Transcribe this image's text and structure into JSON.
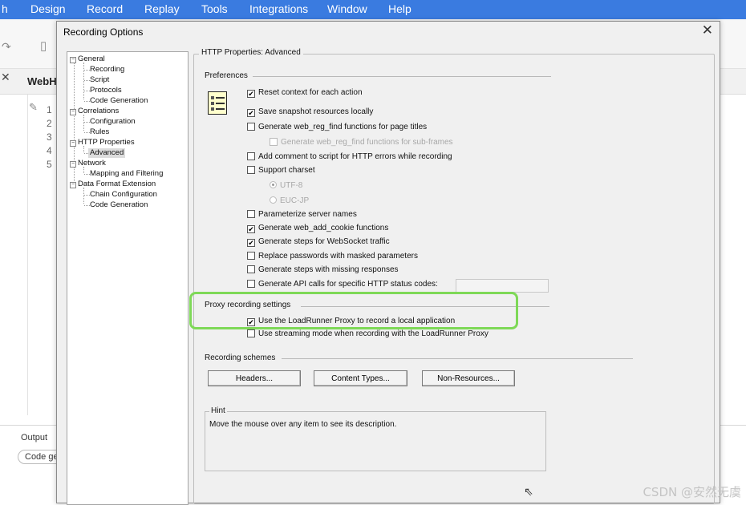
{
  "menubar": {
    "items": [
      "h",
      "Design",
      "Record",
      "Replay",
      "Tools",
      "Integrations",
      "Window",
      "Help"
    ]
  },
  "background": {
    "editor_tab": "WebH",
    "line_numbers": [
      "1",
      "2",
      "3",
      "4",
      "5"
    ],
    "output_label": "Output",
    "output_button": "Code ge",
    "accent_color": "#3a7be0"
  },
  "dialog": {
    "title": "Recording Options",
    "close_glyph": "✕"
  },
  "tree": [
    {
      "label": "General",
      "level": 0,
      "expander": "−"
    },
    {
      "label": "Recording",
      "level": 1
    },
    {
      "label": "Script",
      "level": 1
    },
    {
      "label": "Protocols",
      "level": 1
    },
    {
      "label": "Code Generation",
      "level": 1
    },
    {
      "label": "Correlations",
      "level": 0,
      "expander": "−"
    },
    {
      "label": "Configuration",
      "level": 1
    },
    {
      "label": "Rules",
      "level": 1
    },
    {
      "label": "HTTP Properties",
      "level": 0,
      "expander": "−"
    },
    {
      "label": "Advanced",
      "level": 1,
      "selected": true
    },
    {
      "label": "Network",
      "level": 0,
      "expander": "−"
    },
    {
      "label": "Mapping and Filtering",
      "level": 1
    },
    {
      "label": "Data Format Extension",
      "level": 0,
      "expander": "−"
    },
    {
      "label": "Chain Configuration",
      "level": 1
    },
    {
      "label": "Code Generation",
      "level": 1
    }
  ],
  "panel": {
    "title": "HTTP Properties: Advanced",
    "preferences_label": "Preferences",
    "preferences": [
      {
        "label": "Reset context for each action",
        "checked": true,
        "enabled": true
      },
      {
        "label": "Save snapshot resources locally",
        "checked": true,
        "enabled": true
      },
      {
        "label": "Generate web_reg_find functions for page titles",
        "checked": false,
        "enabled": true
      },
      {
        "label": "Generate web_reg_find functions for sub-frames",
        "checked": false,
        "enabled": false
      },
      {
        "label": "Add comment to script for HTTP errors while recording",
        "checked": false,
        "enabled": true
      },
      {
        "label": "Support charset",
        "checked": false,
        "enabled": true
      }
    ],
    "charset_options": [
      {
        "label": "UTF-8",
        "selected": true
      },
      {
        "label": "EUC-JP",
        "selected": false
      }
    ],
    "preferences_2": [
      {
        "label": "Parameterize server names",
        "checked": false
      },
      {
        "label": "Generate web_add_cookie functions",
        "checked": true
      },
      {
        "label": "Generate steps for WebSocket traffic",
        "checked": true
      },
      {
        "label": "Replace passwords with masked parameters",
        "checked": false
      },
      {
        "label": "Generate steps with missing responses",
        "checked": false
      },
      {
        "label": "Generate API calls for specific HTTP status codes:",
        "checked": false
      }
    ],
    "status_codes_value": "",
    "proxy_label": "Proxy recording settings",
    "proxy_options": [
      {
        "label": "Use the LoadRunner Proxy to record a local application",
        "checked": true
      },
      {
        "label": "Use streaming mode when recording with the LoadRunner Proxy",
        "checked": false
      }
    ],
    "schemes_label": "Recording schemes",
    "scheme_buttons": [
      "Headers...",
      "Content Types...",
      "Non-Resources..."
    ],
    "hint_label": "Hint",
    "hint_text": "Move the mouse over any item to see its description."
  },
  "highlight_color": "#7ed957",
  "watermark": "CSDN @安然无虞"
}
